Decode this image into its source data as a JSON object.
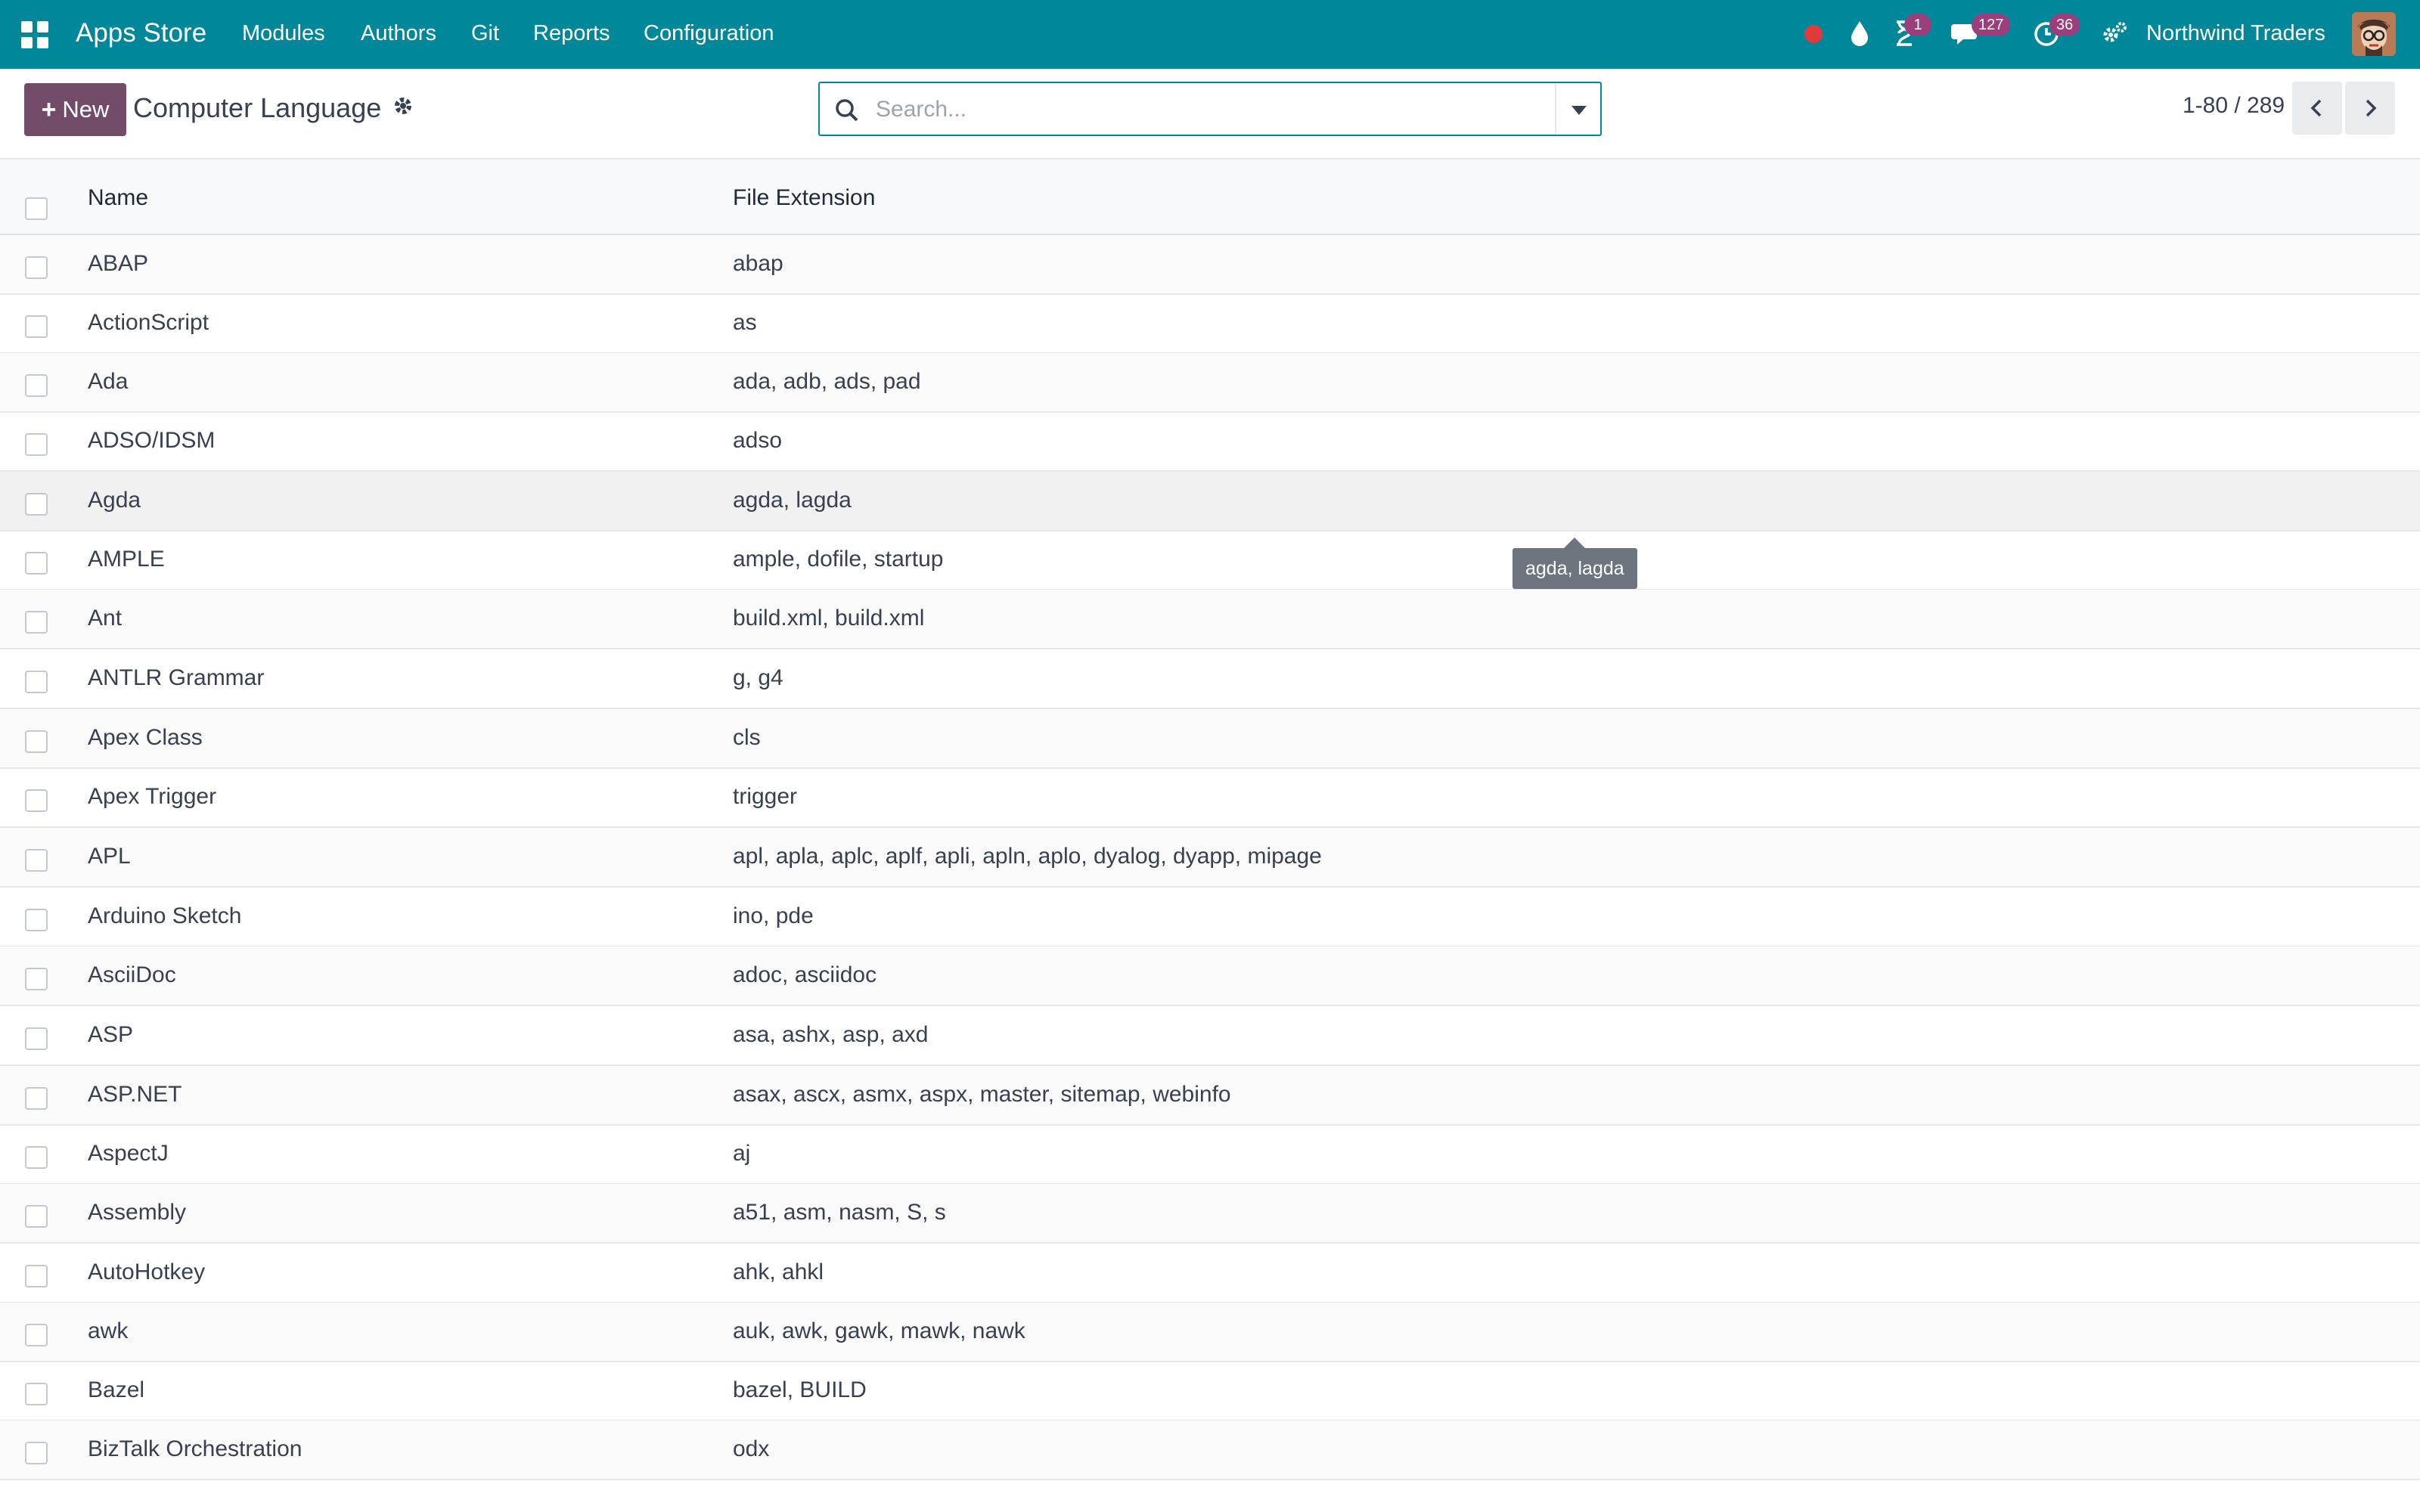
{
  "navbar": {
    "app_title": "Apps Store",
    "menu": [
      "Modules",
      "Authors",
      "Git",
      "Reports",
      "Configuration"
    ],
    "badges": {
      "activities": "1",
      "messages": "127",
      "timesheet": "36"
    },
    "company": "Northwind Traders",
    "icons": [
      "apps-grid-icon",
      "record-icon",
      "drop-icon",
      "hourglass-icon",
      "chat-icon",
      "clock-icon",
      "settings-icon"
    ],
    "colors": {
      "bar": "#00879a",
      "badge": "#9b3f7c",
      "record": "#e03b3b"
    }
  },
  "control": {
    "new_label": "New",
    "breadcrumb": "Computer Language",
    "search_placeholder": "Search...",
    "pager": "1-80 / 289",
    "colors": {
      "primary": "#714b67"
    }
  },
  "table": {
    "columns": [
      "Name",
      "File Extension"
    ],
    "rows": [
      {
        "name": "ABAP",
        "ext": "abap"
      },
      {
        "name": "ActionScript",
        "ext": "as"
      },
      {
        "name": "Ada",
        "ext": "ada, adb, ads, pad"
      },
      {
        "name": "ADSO/IDSM",
        "ext": "adso"
      },
      {
        "name": "Agda",
        "ext": "agda, lagda"
      },
      {
        "name": "AMPLE",
        "ext": "ample, dofile, startup"
      },
      {
        "name": "Ant",
        "ext": "build.xml, build.xml"
      },
      {
        "name": "ANTLR Grammar",
        "ext": "g, g4"
      },
      {
        "name": "Apex Class",
        "ext": "cls"
      },
      {
        "name": "Apex Trigger",
        "ext": "trigger"
      },
      {
        "name": "APL",
        "ext": "apl, apla, aplc, aplf, apli, apln, aplo, dyalog, dyapp, mipage"
      },
      {
        "name": "Arduino Sketch",
        "ext": "ino, pde"
      },
      {
        "name": "AsciiDoc",
        "ext": "adoc, asciidoc"
      },
      {
        "name": "ASP",
        "ext": "asa, ashx, asp, axd"
      },
      {
        "name": "ASP.NET",
        "ext": "asax, ascx, asmx, aspx, master, sitemap, webinfo"
      },
      {
        "name": "AspectJ",
        "ext": "aj"
      },
      {
        "name": "Assembly",
        "ext": "a51, asm, nasm, S, s"
      },
      {
        "name": "AutoHotkey",
        "ext": "ahk, ahkl"
      },
      {
        "name": "awk",
        "ext": "auk, awk, gawk, mawk, nawk"
      },
      {
        "name": "Bazel",
        "ext": "bazel, BUILD"
      },
      {
        "name": "BizTalk Orchestration",
        "ext": "odx"
      }
    ]
  },
  "tooltip": {
    "text": "agda, lagda"
  }
}
